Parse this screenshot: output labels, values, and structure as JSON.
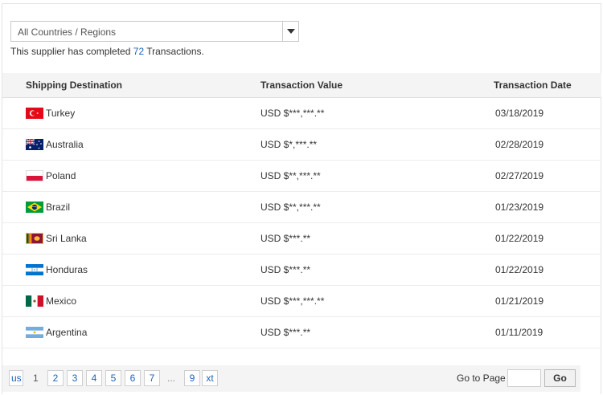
{
  "filter": {
    "selected": "All Countries / Regions"
  },
  "summary": {
    "prefix": "This supplier has completed",
    "count": "72",
    "suffix": "Transactions."
  },
  "table": {
    "headers": [
      "Shipping Destination",
      "Transaction Value",
      "Transaction Date"
    ],
    "rows": [
      {
        "country": "Turkey",
        "flag": "turkey-flag-icon",
        "value": "USD $***,***.**",
        "date": "03/18/2019"
      },
      {
        "country": "Australia",
        "flag": "australia-flag-icon",
        "value": "USD $*,***.**",
        "date": "02/28/2019"
      },
      {
        "country": "Poland",
        "flag": "poland-flag-icon",
        "value": "USD $**,***.**",
        "date": "02/27/2019"
      },
      {
        "country": "Brazil",
        "flag": "brazil-flag-icon",
        "value": "USD $**,***.**",
        "date": "01/23/2019"
      },
      {
        "country": "Sri Lanka",
        "flag": "sri-lanka-flag-icon",
        "value": "USD $***.**",
        "date": "01/22/2019"
      },
      {
        "country": "Honduras",
        "flag": "honduras-flag-icon",
        "value": "USD $***.**",
        "date": "01/22/2019"
      },
      {
        "country": "Mexico",
        "flag": "mexico-flag-icon",
        "value": "USD $***,***.**",
        "date": "01/21/2019"
      },
      {
        "country": "Argentina",
        "flag": "argentina-flag-icon",
        "value": "USD $***.**",
        "date": "01/11/2019"
      }
    ]
  },
  "pagination": {
    "prev_label": "us",
    "current": "1",
    "pages": [
      "2",
      "3",
      "4",
      "5",
      "6",
      "7"
    ],
    "ellipsis": "...",
    "last": "9",
    "next_label": "xt",
    "goto_label": "Go to Page",
    "go_label": "Go"
  }
}
